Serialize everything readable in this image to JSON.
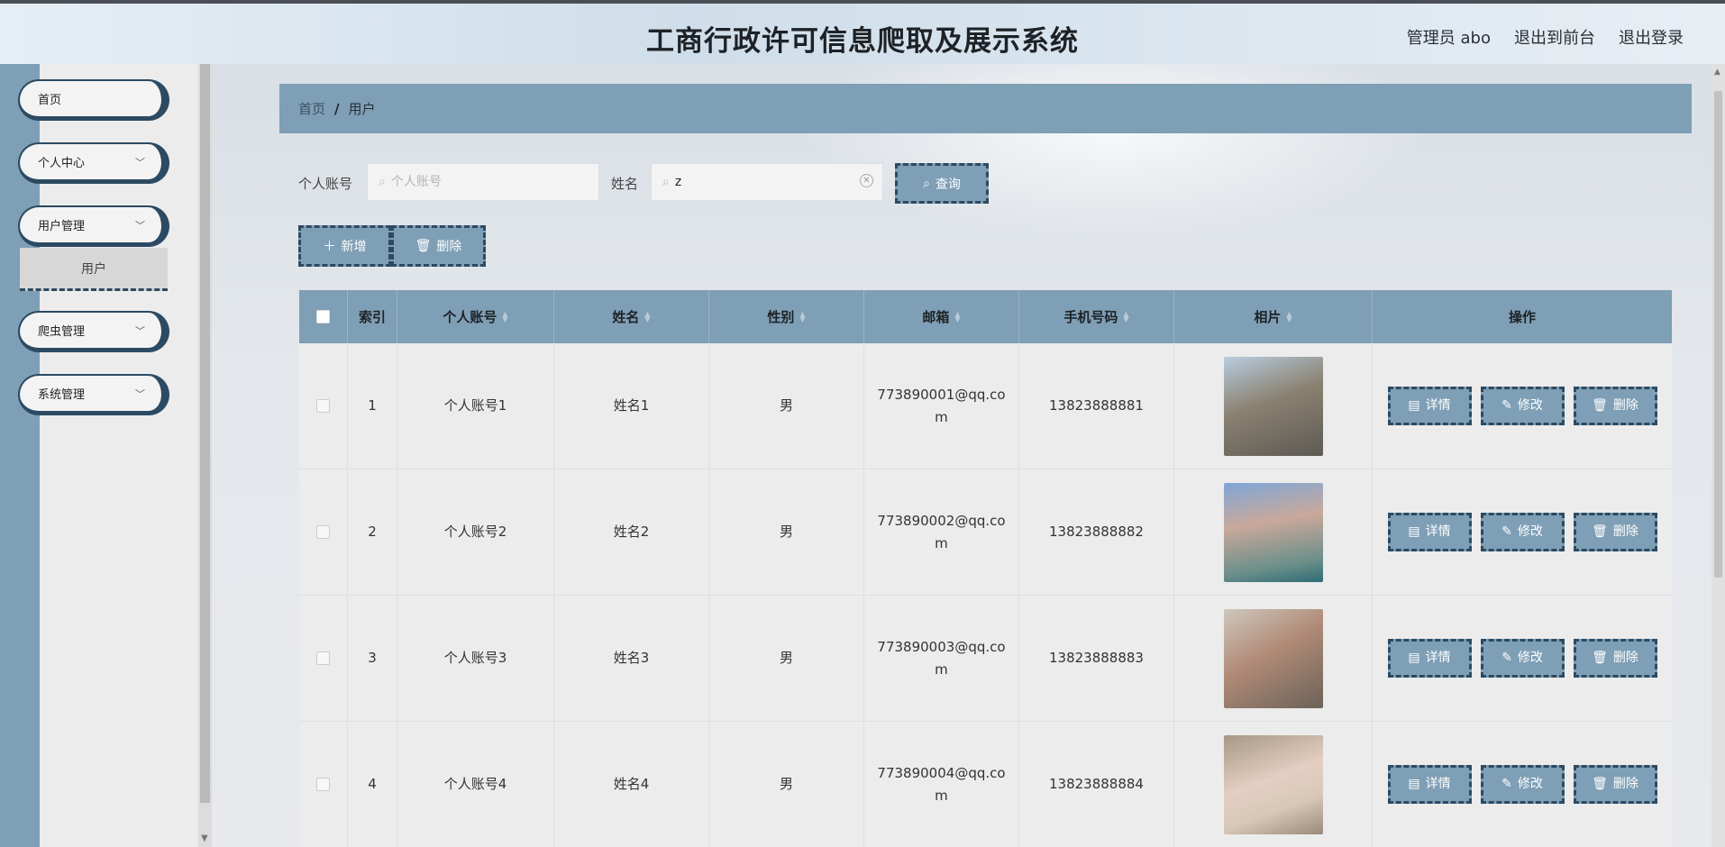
{
  "header": {
    "title": "工商行政许可信息爬取及展示系统",
    "admin_label": "管理员 abo",
    "to_front_label": "退出到前台",
    "logout_label": "退出登录"
  },
  "sidebar": {
    "items": [
      {
        "label": "首页"
      },
      {
        "label": "个人中心"
      },
      {
        "label": "用户管理"
      },
      {
        "label": "爬虫管理"
      },
      {
        "label": "系统管理"
      }
    ],
    "submenu_user": "用户"
  },
  "breadcrumb": {
    "home": "首页",
    "separator": "/",
    "current": "用户"
  },
  "search": {
    "account_label": "个人账号",
    "account_placeholder": "个人账号",
    "name_label": "姓名",
    "name_value": "z",
    "query_label": "查询"
  },
  "actions": {
    "add_label": "新增",
    "delete_label": "删除"
  },
  "table": {
    "headers": {
      "index": "索引",
      "account": "个人账号",
      "name": "姓名",
      "sex": "性别",
      "email": "邮箱",
      "phone": "手机号码",
      "photo": "相片",
      "ops": "操作"
    },
    "op_labels": {
      "detail": "详情",
      "edit": "修改",
      "delete": "删除"
    },
    "rows": [
      {
        "index": "1",
        "account": "个人账号1",
        "name": "姓名1",
        "sex": "男",
        "email_a": "773890001@qq.co",
        "email_b": "m",
        "phone": "13823888881"
      },
      {
        "index": "2",
        "account": "个人账号2",
        "name": "姓名2",
        "sex": "男",
        "email_a": "773890002@qq.co",
        "email_b": "m",
        "phone": "13823888882"
      },
      {
        "index": "3",
        "account": "个人账号3",
        "name": "姓名3",
        "sex": "男",
        "email_a": "773890003@qq.co",
        "email_b": "m",
        "phone": "13823888883"
      },
      {
        "index": "4",
        "account": "个人账号4",
        "name": "姓名4",
        "sex": "男",
        "email_a": "773890004@qq.co",
        "email_b": "m",
        "phone": "13823888884"
      }
    ]
  },
  "colors": {
    "accent": "#7e9fb6",
    "dark_border": "#2c4a62"
  }
}
